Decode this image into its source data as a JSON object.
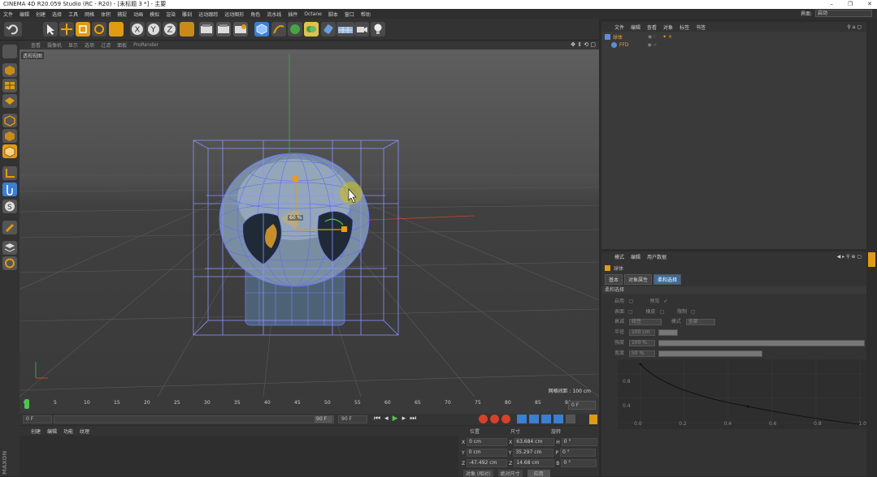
{
  "window": {
    "title": "CINEMA 4D R20.059 Studio (RC - R20) - [未标题 3 *] - 主要",
    "controls": [
      "–",
      "❐",
      "✕"
    ]
  },
  "menu": {
    "items": [
      "文件",
      "编辑",
      "创建",
      "选择",
      "工具",
      "网格",
      "体积",
      "捕捉",
      "动画",
      "模拟",
      "渲染",
      "雕刻",
      "运动跟踪",
      "运动图形",
      "角色",
      "流水线",
      "插件",
      "Octane",
      "脚本",
      "窗口",
      "帮助"
    ],
    "layout_label": "界面:",
    "layout_value": "启动"
  },
  "viewport": {
    "menu": [
      "查看",
      "摄像机",
      "显示",
      "选项",
      "过滤",
      "面板",
      "ProRender"
    ],
    "view_name": "透视视图",
    "grid_spacing": "网格间距 : 100 cm",
    "gizmo_label": "60 %"
  },
  "timeline": {
    "ticks": [
      "0",
      "5",
      "10",
      "15",
      "20",
      "25",
      "30",
      "35",
      "40",
      "45",
      "50",
      "55",
      "60",
      "65",
      "70",
      "75",
      "80",
      "85",
      "90"
    ],
    "end_frame": "0 F"
  },
  "playback": {
    "start": "0 F",
    "current": "90 F",
    "end": "90 F"
  },
  "material_panel": {
    "menu": [
      "创建",
      "编辑",
      "功能",
      "纹理"
    ]
  },
  "coord_panel": {
    "headers": [
      "位置",
      "尺寸",
      "旋转"
    ],
    "rows": [
      {
        "axis": "X",
        "pos": "0 cm",
        "size_axis": "X",
        "size": "63.684 cm",
        "rot_axis": "H",
        "rot": "0 °"
      },
      {
        "axis": "Y",
        "pos": "0 cm",
        "size_axis": "Y",
        "size": "35.297 cm",
        "rot_axis": "P",
        "rot": "0 °"
      },
      {
        "axis": "Z",
        "pos": "-47.492 cm",
        "size_axis": "Z",
        "size": "14.68 cm",
        "rot_axis": "B",
        "rot": "0 °"
      }
    ],
    "mode": "对象 (相对)",
    "size_mode": "绝对尺寸",
    "apply": "应用"
  },
  "object_manager": {
    "menu": [
      "文件",
      "编辑",
      "查看",
      "对象",
      "标签",
      "书签"
    ],
    "objects": [
      {
        "name": "球体",
        "color": "#e8a33a"
      },
      {
        "name": "FFD",
        "color": "#e8a33a"
      }
    ]
  },
  "attributes": {
    "menu": [
      "模式",
      "编辑",
      "用户数据"
    ],
    "object_title": "球体",
    "tabs": [
      "基本",
      "对象属性",
      "柔和选择"
    ],
    "active_tab": "柔和选择",
    "section": "柔和选择",
    "enable_label": "启用",
    "preview_label": "预览",
    "surface_label": "表面",
    "rubber_label": "橡皮",
    "restrict_label": "限制",
    "mode_label": "衰减",
    "mode_value": "线性",
    "shape_label": "模式",
    "shape_value": "全部",
    "radius_label": "半径",
    "radius_value": "100 cm",
    "strength_label": "强度",
    "strength_value": "100 %",
    "width_label": "宽度",
    "width_value": "50 %",
    "curve_y": [
      "0.8",
      "0.4"
    ],
    "curve_x": [
      "0.0",
      "0.2",
      "0.4",
      "0.6",
      "0.8",
      "1.0"
    ]
  },
  "colors": {
    "accent": "#3e6a9b",
    "object_orange": "#e8a33a",
    "cage_blue": "#6c79ff"
  }
}
